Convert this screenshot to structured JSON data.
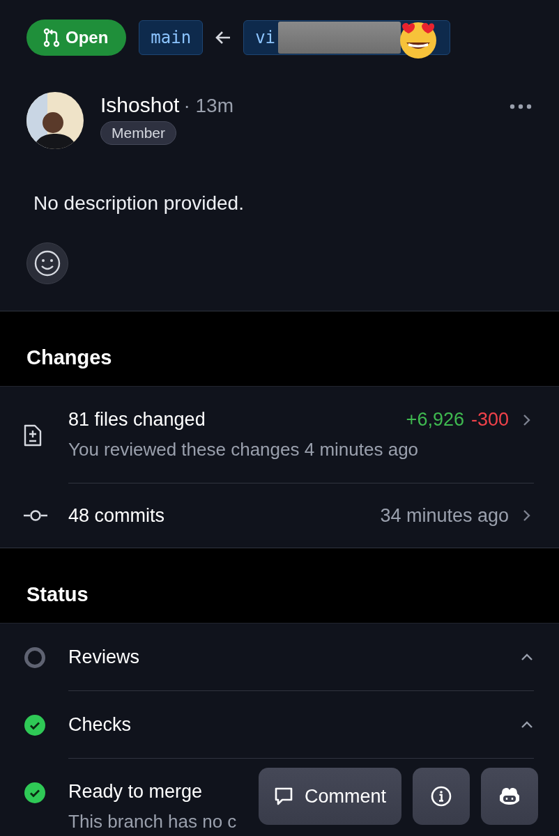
{
  "pull_request": {
    "state": "Open",
    "base_branch": "main",
    "head_branch": "vi"
  },
  "author": {
    "name": "Ishoshot",
    "time": "· 13m",
    "role": "Member"
  },
  "description": "No description provided.",
  "changes": {
    "title": "Changes",
    "rows": [
      {
        "kind": "files",
        "title": "81 files changed",
        "subtitle": "You reviewed these changes 4 minutes ago",
        "additions": "+6,926",
        "deletions": "-300"
      },
      {
        "kind": "commits",
        "title": "48 commits",
        "meta": "34 minutes ago"
      }
    ]
  },
  "status": {
    "title": "Status",
    "rows": [
      {
        "kind": "group",
        "done": false,
        "title": "Reviews",
        "expanded": true
      },
      {
        "kind": "group",
        "done": true,
        "title": "Checks",
        "expanded": true
      },
      {
        "kind": "item",
        "done": true,
        "title": "Ready to merge",
        "subtitle": "This branch has no c"
      }
    ]
  },
  "actions": [
    {
      "kind": "comment",
      "label": "Comment"
    },
    {
      "kind": "info"
    },
    {
      "kind": "copilot"
    }
  ]
}
